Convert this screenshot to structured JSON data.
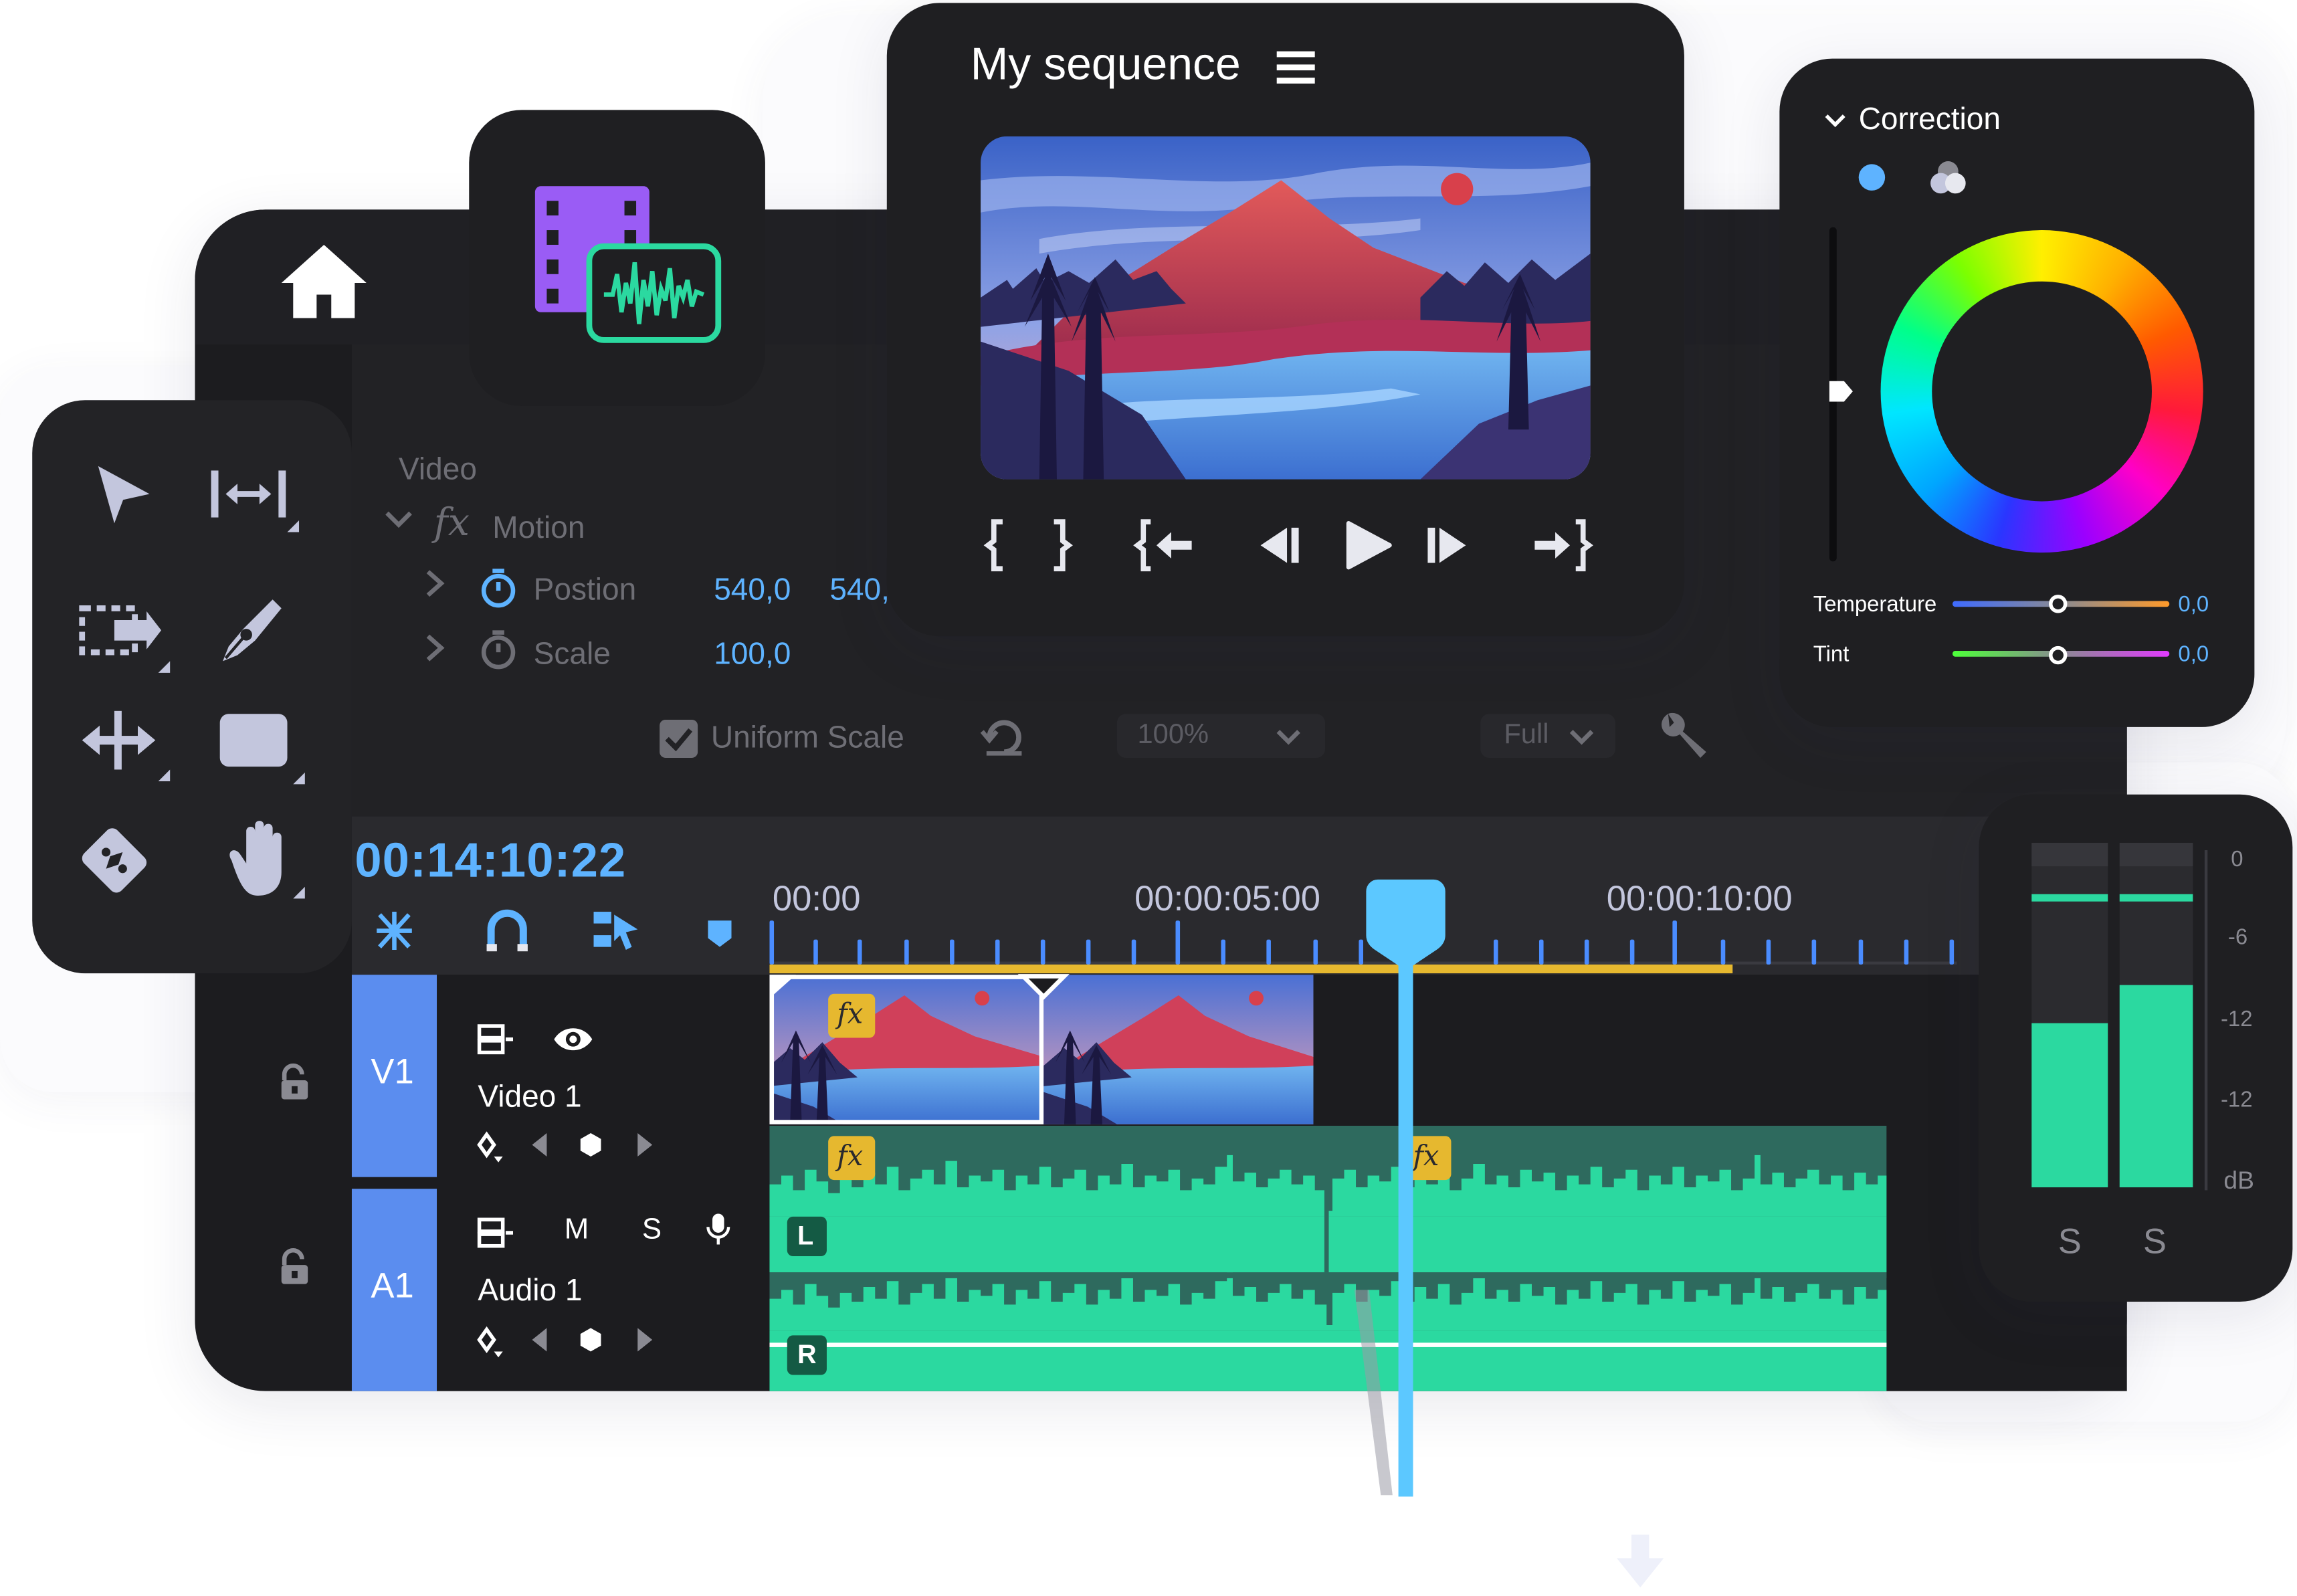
{
  "preview": {
    "title": "My sequence",
    "menu_icon": "hamburger-icon"
  },
  "effects": {
    "section_label": "Video",
    "fx_label": "fx",
    "motion_label": "Motion",
    "position_label": "Postion",
    "position_x": "540,0",
    "position_y": "540,",
    "scale_label": "Scale",
    "scale_value": "100,0",
    "uniform_scale_label": "Uniform Scale",
    "uniform_scale_checked": true,
    "zoom_value": "100%",
    "quality_value": "Full"
  },
  "timeline": {
    "timecode": "00:14:10:22",
    "ruler_labels": [
      "00:00",
      "00:00:05:00",
      "00:00:10:00"
    ],
    "tracks": [
      {
        "id": "V1",
        "name": "Video 1"
      },
      {
        "id": "A1",
        "name": "Audio 1",
        "mute": "M",
        "solo": "S"
      }
    ],
    "fx_badge": "fx",
    "channel_left": "L",
    "channel_right": "R"
  },
  "color_correction": {
    "title": "Correction",
    "temperature_label": "Temperature",
    "temperature_value": "0,0",
    "tint_label": "Tint",
    "tint_value": "0,0"
  },
  "audio_meter": {
    "scale": [
      "0",
      "-6",
      "-12",
      "-12",
      "dB"
    ],
    "solo_left": "S",
    "solo_right": "S",
    "level_left": 0.52,
    "level_right": 0.64
  },
  "colors": {
    "panel": "#1e1e21",
    "accent_blue": "#5eb3ff",
    "waveform_green": "#2bd9a0",
    "track_blue": "#5b8def",
    "playhead": "#5cc8ff",
    "fx_badge": "#e6b82f",
    "in_out_bar": "#e6b82f"
  }
}
